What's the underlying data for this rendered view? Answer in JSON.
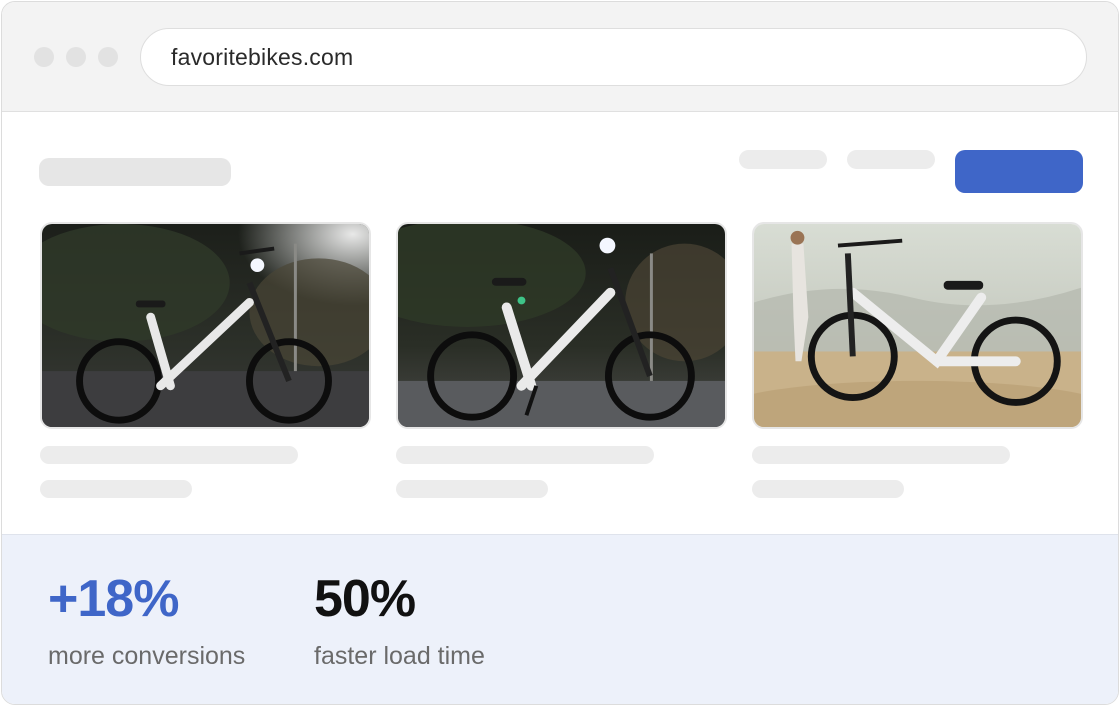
{
  "browser": {
    "url": "favoritebikes.com"
  },
  "colors": {
    "accent": "#3f66c8",
    "stats_background": "#edf1fa"
  },
  "products": [
    {
      "image": "white step-through e-bike at night street"
    },
    {
      "image": "white step-through e-bike at night with kickstand"
    },
    {
      "image": "white e-bike on sandy hill with woman in background"
    }
  ],
  "stats": [
    {
      "value": "+18%",
      "label": "more conversions",
      "color": "#3f66c8"
    },
    {
      "value": "50%",
      "label": "faster load time",
      "color": "#111111"
    }
  ]
}
